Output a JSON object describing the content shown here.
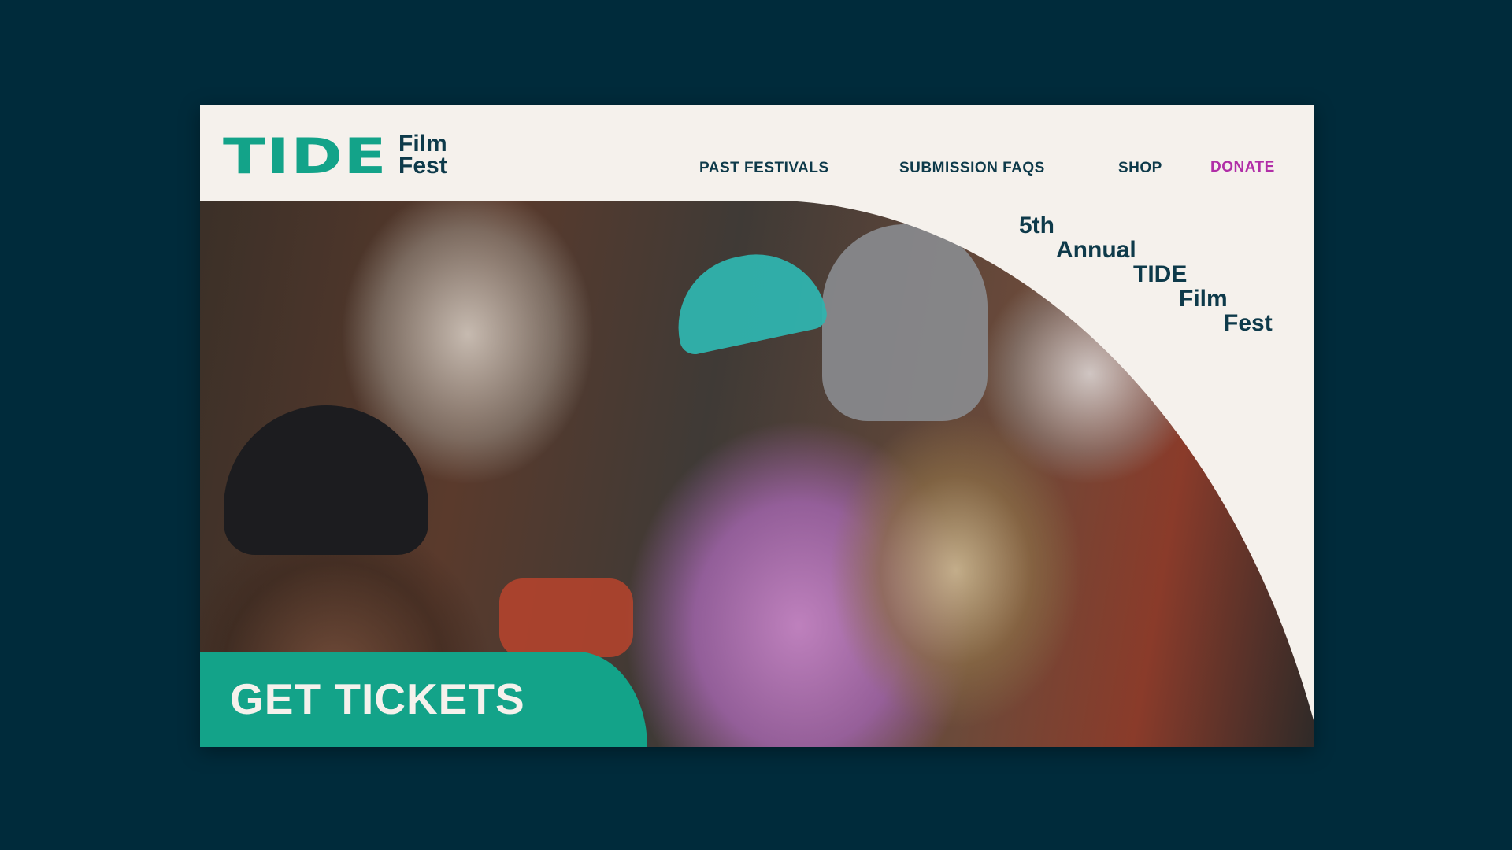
{
  "header": {
    "logo": {
      "main": "TIDE",
      "sub_line1": "Film",
      "sub_line2": "Fest"
    },
    "nav": [
      {
        "label": "PAST FESTIVALS"
      },
      {
        "label": "SUBMISSION FAQS"
      },
      {
        "label": "SHOP"
      },
      {
        "label": "DONATE"
      }
    ]
  },
  "hero": {
    "headline_lines": [
      "5th",
      "Annual",
      "TIDE",
      "Film",
      "Fest"
    ],
    "cta_label": "GET TICKETS"
  },
  "colors": {
    "page_background": "#002b3b",
    "site_background": "#f5f1ec",
    "brand_teal": "#13a389",
    "text_navy": "#0e3a4a",
    "donate_magenta": "#b12ea7"
  }
}
